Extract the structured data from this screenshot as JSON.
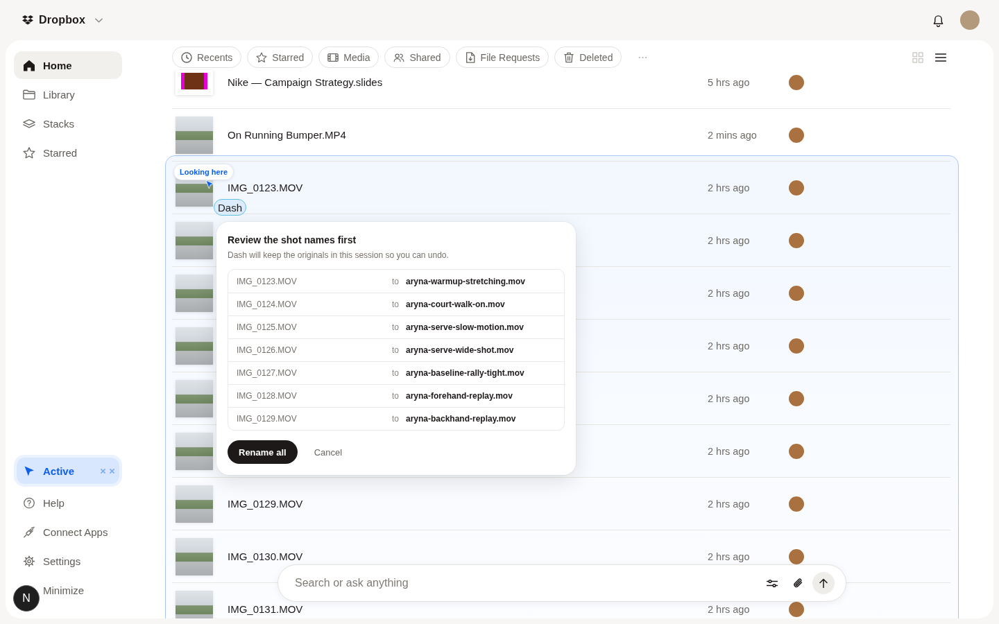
{
  "header": {
    "brand": "Dropbox"
  },
  "sidebar": {
    "nav": [
      {
        "label": "Home",
        "selected": true
      },
      {
        "label": "Library",
        "selected": false
      },
      {
        "label": "Stacks",
        "selected": false
      },
      {
        "label": "Starred",
        "selected": false
      }
    ],
    "footer": [
      {
        "label": "Active",
        "selected": true
      },
      {
        "label": "Help",
        "selected": false
      },
      {
        "label": "Connect Apps",
        "selected": false
      },
      {
        "label": "Settings",
        "selected": false
      },
      {
        "label": "Minimize",
        "selected": false
      }
    ],
    "account_initial": "N"
  },
  "filters": [
    {
      "label": "Recents",
      "selected": false
    },
    {
      "label": "Starred",
      "selected": false
    },
    {
      "label": "Media",
      "selected": false
    },
    {
      "label": "Shared",
      "selected": false
    },
    {
      "label": "File Requests",
      "selected": false
    },
    {
      "label": "Deleted",
      "selected": false
    }
  ],
  "view_modes": [
    {
      "kind": "grid",
      "selected": false
    },
    {
      "kind": "list",
      "selected": true
    }
  ],
  "files": [
    {
      "kind": "slides",
      "name": "Nike — Campaign Strategy.slides",
      "modified": "5 hrs ago"
    },
    {
      "kind": "video",
      "name": "On Running Bumper.MP4",
      "modified": "2 mins ago"
    },
    {
      "kind": "video",
      "name": "IMG_0123.MOV",
      "modified": "2 hrs ago"
    },
    {
      "kind": "video",
      "modified": "2 hrs ago"
    },
    {
      "kind": "video",
      "modified": "2 hrs ago"
    },
    {
      "kind": "video",
      "modified": "2 hrs ago"
    },
    {
      "kind": "video",
      "modified": "2 hrs ago"
    },
    {
      "kind": "video",
      "modified": "2 hrs ago"
    },
    {
      "kind": "video",
      "name": "IMG_0129.MOV",
      "modified": "2 hrs ago"
    },
    {
      "kind": "video",
      "name": "IMG_0130.MOV",
      "modified": "2 hrs ago"
    },
    {
      "kind": "video",
      "name": "IMG_0131.MOV",
      "modified": "2 hrs ago"
    }
  ],
  "agent_focus": {
    "hint": "Looking here",
    "agent": "Dash"
  },
  "dialog": {
    "title": "Review the shot names first",
    "subtitle": "Dash will keep the originals in this session so you can undo.",
    "renames": [
      {
        "old_name": "IMG_0123.MOV",
        "joiner": "to",
        "new_name": "aryna-warmup-stretching.mov"
      },
      {
        "old_name": "IMG_0124.MOV",
        "joiner": "to",
        "new_name": "aryna-court-walk-on.mov"
      },
      {
        "old_name": "IMG_0125.MOV",
        "joiner": "to",
        "new_name": "aryna-serve-slow-motion.mov"
      },
      {
        "old_name": "IMG_0126.MOV",
        "joiner": "to",
        "new_name": "aryna-serve-wide-shot.mov"
      },
      {
        "old_name": "IMG_0127.MOV",
        "joiner": "to",
        "new_name": "aryna-baseline-rally-tight.mov"
      },
      {
        "old_name": "IMG_0128.MOV",
        "joiner": "to",
        "new_name": "aryna-forehand-replay.mov"
      },
      {
        "old_name": "IMG_0129.MOV",
        "joiner": "to",
        "new_name": "aryna-backhand-replay.mov"
      }
    ],
    "confirm": "Rename all",
    "cancel": "Cancel"
  },
  "search": {
    "placeholder": "Search or ask anything"
  }
}
